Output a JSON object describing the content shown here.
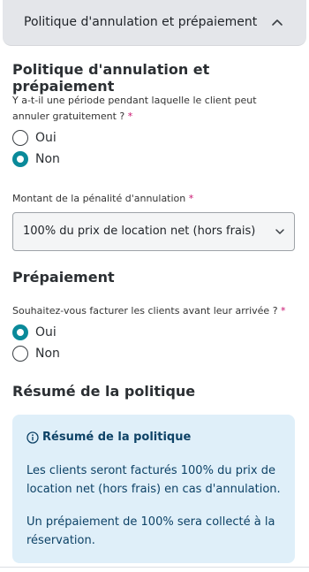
{
  "accordion": {
    "title": "Politique d'annulation et prépaiement"
  },
  "cancellation": {
    "title": "Politique d'annulation et prépaiement",
    "question": "Y a-t-il une période pendant laquelle le client peut annuler gratuitement ?",
    "required_mark": "*",
    "options": [
      {
        "label": "Oui",
        "checked": false
      },
      {
        "label": "Non",
        "checked": true
      }
    ]
  },
  "penalty": {
    "label": "Montant de la pénalité d'annulation",
    "required_mark": "*",
    "selected": "100% du prix de location net (hors frais)"
  },
  "prepayment": {
    "title": "Prépaiement",
    "question": "Souhaitez-vous facturer les clients avant leur arrivée ?",
    "required_mark": "*",
    "options": [
      {
        "label": "Oui",
        "checked": true
      },
      {
        "label": "Non",
        "checked": false
      }
    ]
  },
  "summary": {
    "title": "Résumé de la politique",
    "box_title": "Résumé de la politique",
    "line1": "Les clients seront facturés 100% du prix de location net (hors frais) en cas d'annulation.",
    "line2": "Un prépaiement de 100% sera collecté à la réservation."
  },
  "colors": {
    "accent": "#0a8a9a",
    "required": "#c8116e",
    "summary_bg": "#dfeff9",
    "summary_text": "#0d4266"
  },
  "icons": {
    "accordion_toggle": "chevron-up-icon",
    "select_toggle": "chevron-down-icon",
    "info": "info-icon"
  }
}
